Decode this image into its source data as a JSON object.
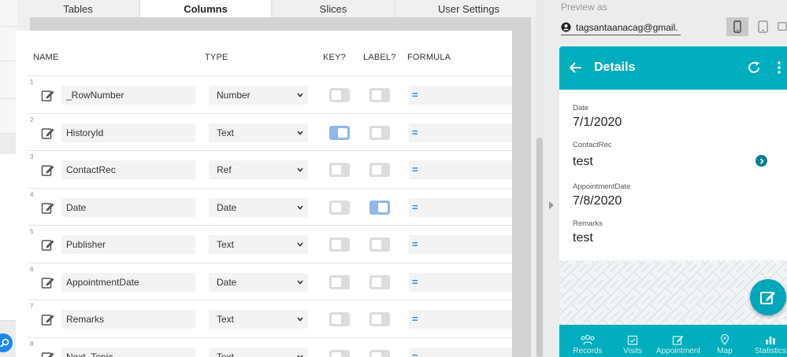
{
  "tabs": [
    {
      "label": "Tables"
    },
    {
      "label": "Columns"
    },
    {
      "label": "Slices"
    },
    {
      "label": "User Settings"
    }
  ],
  "table": {
    "headers": {
      "name": "NAME",
      "type": "TYPE",
      "key": "KEY?",
      "label": "LABEL?",
      "formula": "FORMULA"
    },
    "rows": [
      {
        "index": "1",
        "name": "_RowNumber",
        "type": "Number",
        "key": false,
        "label": false,
        "formula": "="
      },
      {
        "index": "2",
        "name": "HistoryId",
        "type": "Text",
        "key": true,
        "label": false,
        "formula": "="
      },
      {
        "index": "3",
        "name": "ContactRec",
        "type": "Ref",
        "key": false,
        "label": false,
        "formula": "="
      },
      {
        "index": "4",
        "name": "Date",
        "type": "Date",
        "key": false,
        "label": true,
        "formula": "="
      },
      {
        "index": "5",
        "name": "Publisher",
        "type": "Text",
        "key": false,
        "label": false,
        "formula": "="
      },
      {
        "index": "6",
        "name": "AppointmentDate",
        "type": "Date",
        "key": false,
        "label": false,
        "formula": "="
      },
      {
        "index": "7",
        "name": "Remarks",
        "type": "Text",
        "key": false,
        "label": false,
        "formula": "="
      },
      {
        "index": "8",
        "name": "Next_Topic",
        "type": "Text",
        "key": false,
        "label": false,
        "formula": "="
      }
    ]
  },
  "preview": {
    "label": "Preview as",
    "email": "tagsantaanacag@gmail.",
    "header_title": "Details",
    "fields": [
      {
        "label": "Date",
        "value": "7/1/2020"
      },
      {
        "label": "ContactRec",
        "value": "test"
      },
      {
        "label": "AppointmentDate",
        "value": "7/8/2020"
      },
      {
        "label": "Remarks",
        "value": "test"
      }
    ],
    "nav": [
      {
        "label": "Records",
        "icon": "people-icon"
      },
      {
        "label": "Visits",
        "icon": "calendar-check-icon"
      },
      {
        "label": "Appointment",
        "icon": "edit-icon"
      },
      {
        "label": "Map",
        "icon": "map-pin-icon"
      },
      {
        "label": "Statistics",
        "icon": "chart-icon"
      }
    ]
  },
  "colors": {
    "accent": "#00aebd",
    "toggle_on": "#8fb8e8",
    "formula": "#1e88e5"
  }
}
